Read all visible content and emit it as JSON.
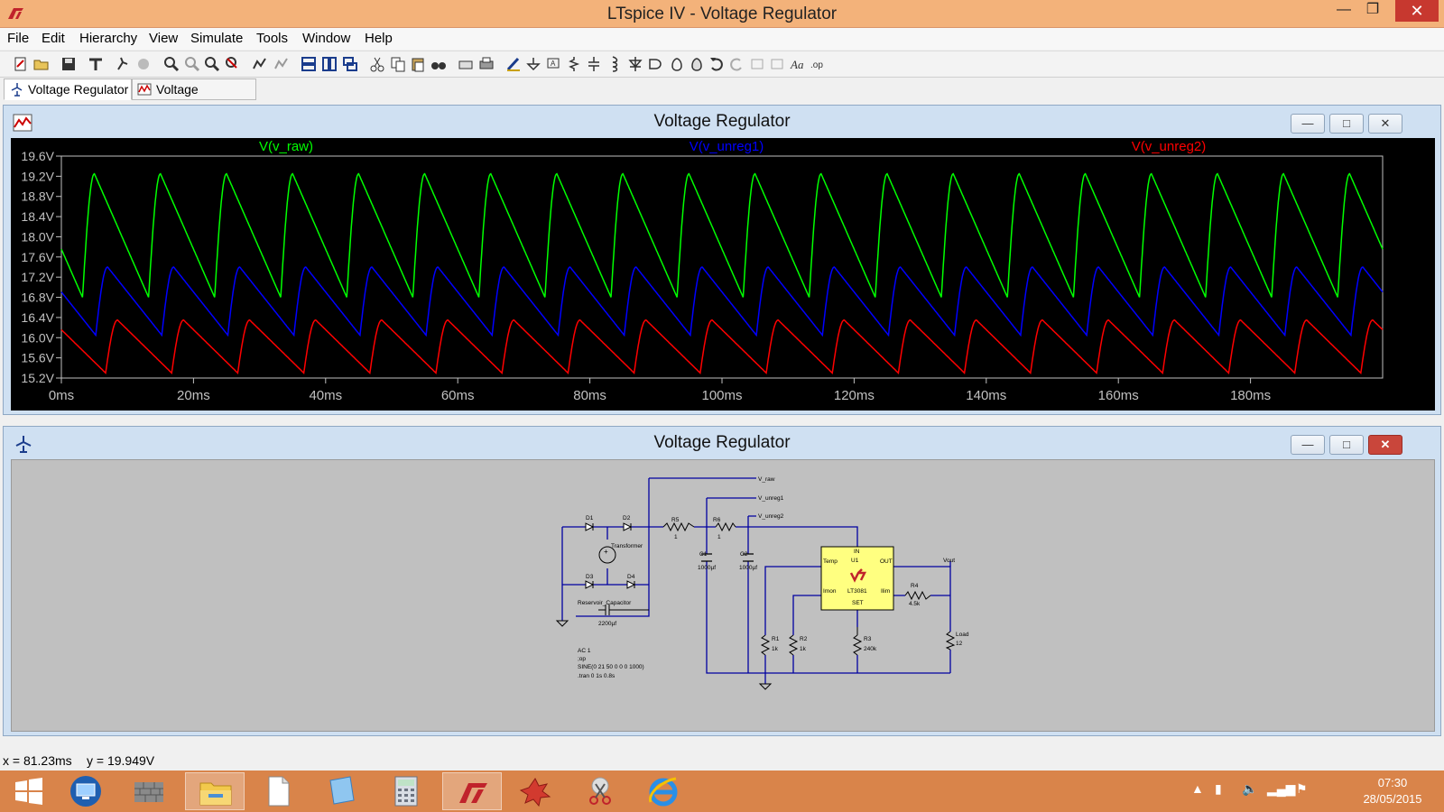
{
  "window": {
    "title": "LTspice IV - Voltage Regulator"
  },
  "menu": [
    "File",
    "Edit",
    "Hierarchy",
    "View",
    "Simulate",
    "Tools",
    "Window",
    "Help"
  ],
  "tabs": [
    {
      "label": "Voltage Regulator",
      "icon": "schematic-icon"
    },
    {
      "label": "Voltage Regulator",
      "icon": "waveform-icon"
    }
  ],
  "plot_window": {
    "title": "Voltage Regulator"
  },
  "schematic_window": {
    "title": "Voltage Regulator"
  },
  "chart_data": {
    "type": "line",
    "xlabel": "",
    "ylabel": "",
    "x_ticks": [
      "0ms",
      "20ms",
      "40ms",
      "60ms",
      "80ms",
      "100ms",
      "120ms",
      "140ms",
      "160ms",
      "180ms"
    ],
    "y_ticks": [
      "19.6V",
      "19.2V",
      "18.8V",
      "18.4V",
      "18.0V",
      "17.6V",
      "17.2V",
      "16.8V",
      "16.4V",
      "16.0V",
      "15.6V",
      "15.2V"
    ],
    "xlim": [
      0,
      200
    ],
    "ylim": [
      15.2,
      19.6
    ],
    "grid": false,
    "period_ms": 10,
    "series": [
      {
        "name": "V(v_raw)",
        "color": "#00ff00",
        "peak_ms": 5,
        "max": 19.25,
        "min": 16.8
      },
      {
        "name": "V(v_unreg1)",
        "color": "#0000ff",
        "peak_ms": 7,
        "max": 17.4,
        "min": 16.05
      },
      {
        "name": "V(v_unreg2)",
        "color": "#ff0000",
        "peak_ms": 8.5,
        "max": 16.35,
        "min": 15.3
      }
    ]
  },
  "schematic": {
    "nets": [
      "V_raw",
      "V_unreg1",
      "V_unreg2",
      "Vout"
    ],
    "diodes": [
      "D1",
      "D2",
      "D3",
      "D4"
    ],
    "transformer": "Transformer",
    "reservoir": {
      "name": "Reservoir_Capacitor",
      "value": "2200µf"
    },
    "resistors": [
      {
        "ref": "R5",
        "value": "1"
      },
      {
        "ref": "R6",
        "value": "1"
      },
      {
        "ref": "R1",
        "value": "1k"
      },
      {
        "ref": "R2",
        "value": "1k"
      },
      {
        "ref": "R3",
        "value": "240k"
      },
      {
        "ref": "R4",
        "value": "4.5k"
      }
    ],
    "capacitors": [
      {
        "ref": "C1",
        "value": "1000µf"
      },
      {
        "ref": "C2",
        "value": "1000µf"
      }
    ],
    "load": {
      "ref": "Load",
      "value": "12"
    },
    "ic": {
      "ref": "U1",
      "part": "LT3081",
      "pins": [
        "IN",
        "OUT",
        "Temp",
        "Imon",
        "Ilim",
        "SET"
      ]
    },
    "directives": [
      "AC 1",
      ";op",
      "SINE(0 21 50 0 0 0 1000)",
      ".tran 0 1s 0.8s"
    ]
  },
  "status": {
    "x": "x = 81.23ms",
    "y": "y = 19.949V"
  },
  "taskbar": {
    "apps": [
      "start-icon",
      "remote-desktop-icon",
      "firewall-icon",
      "file-explorer-icon",
      "document-icon",
      "notepad-icon",
      "calculator-icon",
      "ltspice-icon",
      "game-icon",
      "snipping-tool-icon",
      "internet-explorer-icon"
    ],
    "time": "07:30",
    "date": "28/05/2015"
  }
}
